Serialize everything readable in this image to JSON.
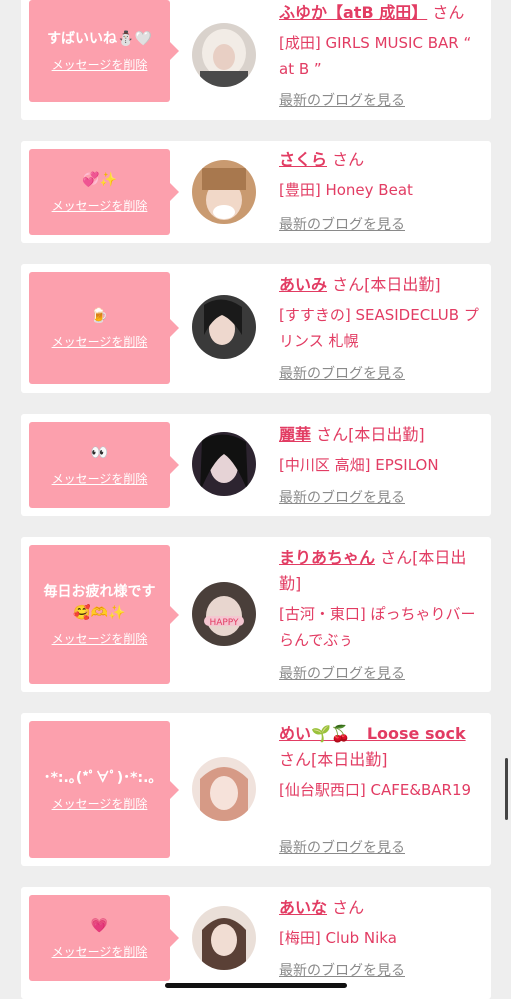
{
  "accent_color": "#e23c63",
  "bubble_color": "#fca0ad",
  "cards": [
    {
      "message": "すばいいね⛄🤍",
      "delete_label": "メッセージを削除",
      "name": "ふゆか【atB 成田】",
      "san": "さん",
      "shop": "[成田] GIRLS MUSIC BAR “ at B ”",
      "blog_label": "最新のブログを見る"
    },
    {
      "message": "💞✨",
      "delete_label": "メッセージを削除",
      "name": "さくら",
      "san": "さん",
      "shop": "[豊田] Honey Beat",
      "blog_label": "最新のブログを見る"
    },
    {
      "message": "🍺",
      "delete_label": "メッセージを削除",
      "name": "あいみ",
      "san": "さん[本日出勤]",
      "shop": "[すすきの] SEASIDECLUB プリンス 札幌",
      "blog_label": "最新のブログを見る"
    },
    {
      "message": "👀",
      "delete_label": "メッセージを削除",
      "name": "麗華",
      "san": "さん[本日出勤]",
      "shop": "[中川区 高畑] EPSILON",
      "blog_label": "最新のブログを見る"
    },
    {
      "message": "毎日お疲れ様です🥰🫶✨",
      "delete_label": "メッセージを削除",
      "name": "まりあちゃん",
      "san": "さん[本日出勤]",
      "shop": "[古河・東口] ぽっちゃりバー らんでぶぅ",
      "blog_label": "最新のブログを見る"
    },
    {
      "message": "･*:.｡(*ﾟ∀ﾟ)･*:.｡",
      "delete_label": "メッセージを削除",
      "name": "めい🌱🍒　Loose sock",
      "san": "さん[本日出勤]",
      "shop": "[仙台駅西口] CAFE&BAR19",
      "blog_label": "最新のブログを見る"
    },
    {
      "message": "💗",
      "delete_label": "メッセージを削除",
      "name": "あいな",
      "san": "さん",
      "shop": "[梅田] Club Nika",
      "blog_label": "最新のブログを見る"
    }
  ]
}
